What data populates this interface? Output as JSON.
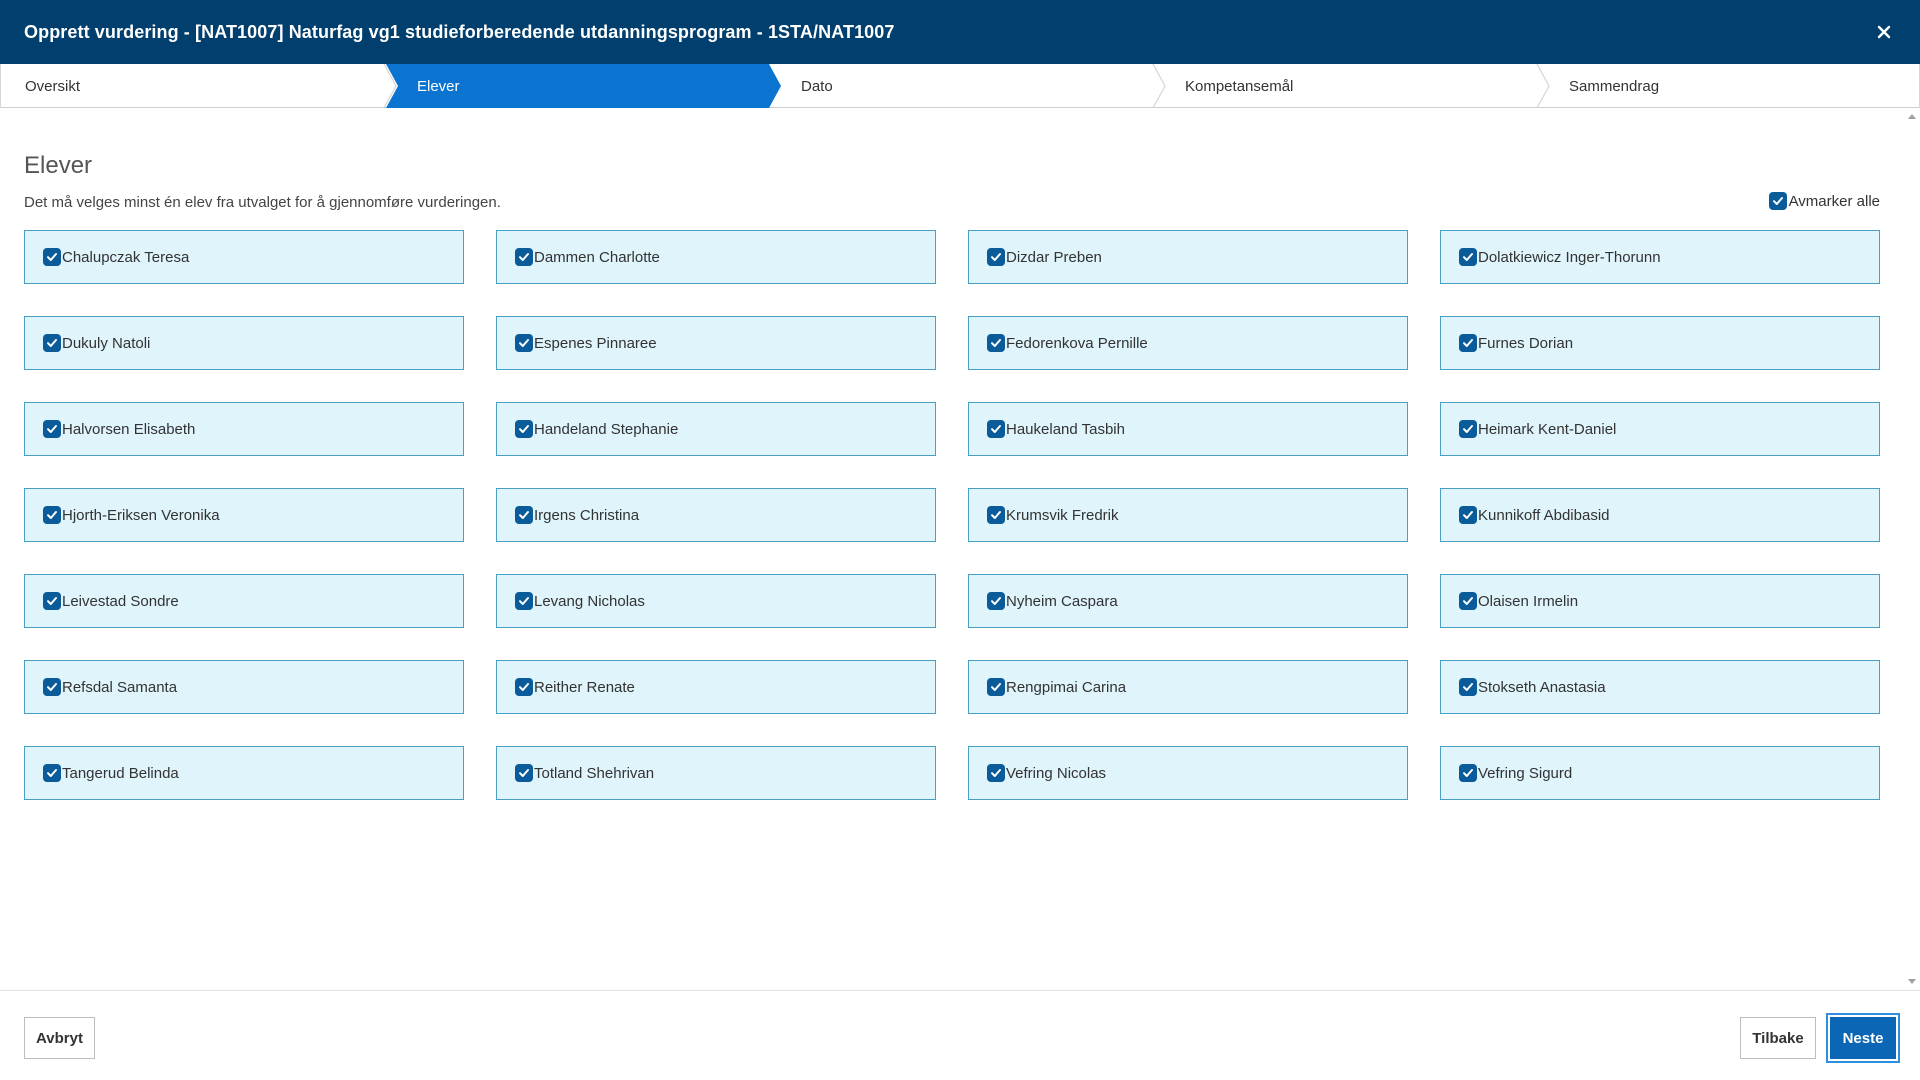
{
  "window": {
    "title": "Opprett vurdering - [NAT1007] Naturfag vg1 studieforberedende utdanningsprogram - 1STA/NAT1007",
    "close_icon": "close-icon"
  },
  "colors": {
    "header_bg": "#003f6e",
    "active_step": "#0a74d0",
    "card_bg": "#dff4fb",
    "card_border": "#4a9fc4",
    "checkbox": "#0a5b99",
    "primary_button": "#0b67b5"
  },
  "steps": [
    {
      "label": "Oversikt",
      "active": false
    },
    {
      "label": "Elever",
      "active": true
    },
    {
      "label": "Dato",
      "active": false
    },
    {
      "label": "Kompetansemål",
      "active": false
    },
    {
      "label": "Sammendrag",
      "active": false
    }
  ],
  "section": {
    "title": "Elever",
    "description": "Det må velges minst én elev fra utvalget for å gjennomføre vurderingen.",
    "toggle_all_label": "Avmarker alle",
    "toggle_all_checked": true
  },
  "students": [
    {
      "name": "Chalupczak Teresa",
      "checked": true
    },
    {
      "name": "Dammen Charlotte",
      "checked": true
    },
    {
      "name": "Dizdar Preben",
      "checked": true
    },
    {
      "name": "Dolatkiewicz Inger-Thorunn",
      "checked": true
    },
    {
      "name": "Dukuly Natoli",
      "checked": true
    },
    {
      "name": "Espenes Pinnaree",
      "checked": true
    },
    {
      "name": "Fedorenkova Pernille",
      "checked": true
    },
    {
      "name": "Furnes Dorian",
      "checked": true
    },
    {
      "name": "Halvorsen Elisabeth",
      "checked": true
    },
    {
      "name": "Handeland Stephanie",
      "checked": true
    },
    {
      "name": "Haukeland Tasbih",
      "checked": true
    },
    {
      "name": "Heimark Kent-Daniel",
      "checked": true
    },
    {
      "name": "Hjorth-Eriksen Veronika",
      "checked": true
    },
    {
      "name": "Irgens Christina",
      "checked": true
    },
    {
      "name": "Krumsvik Fredrik",
      "checked": true
    },
    {
      "name": "Kunnikoff Abdibasid",
      "checked": true
    },
    {
      "name": "Leivestad Sondre",
      "checked": true
    },
    {
      "name": "Levang Nicholas",
      "checked": true
    },
    {
      "name": "Nyheim Caspara",
      "checked": true
    },
    {
      "name": "Olaisen Irmelin",
      "checked": true
    },
    {
      "name": "Refsdal Samanta",
      "checked": true
    },
    {
      "name": "Reither Renate",
      "checked": true
    },
    {
      "name": "Rengpimai Carina",
      "checked": true
    },
    {
      "name": "Stokseth Anastasia",
      "checked": true
    },
    {
      "name": "Tangerud Belinda",
      "checked": true
    },
    {
      "name": "Totland Shehrivan",
      "checked": true
    },
    {
      "name": "Vefring Nicolas",
      "checked": true
    },
    {
      "name": "Vefring Sigurd",
      "checked": true
    }
  ],
  "footer": {
    "cancel_label": "Avbryt",
    "back_label": "Tilbake",
    "next_label": "Neste"
  }
}
